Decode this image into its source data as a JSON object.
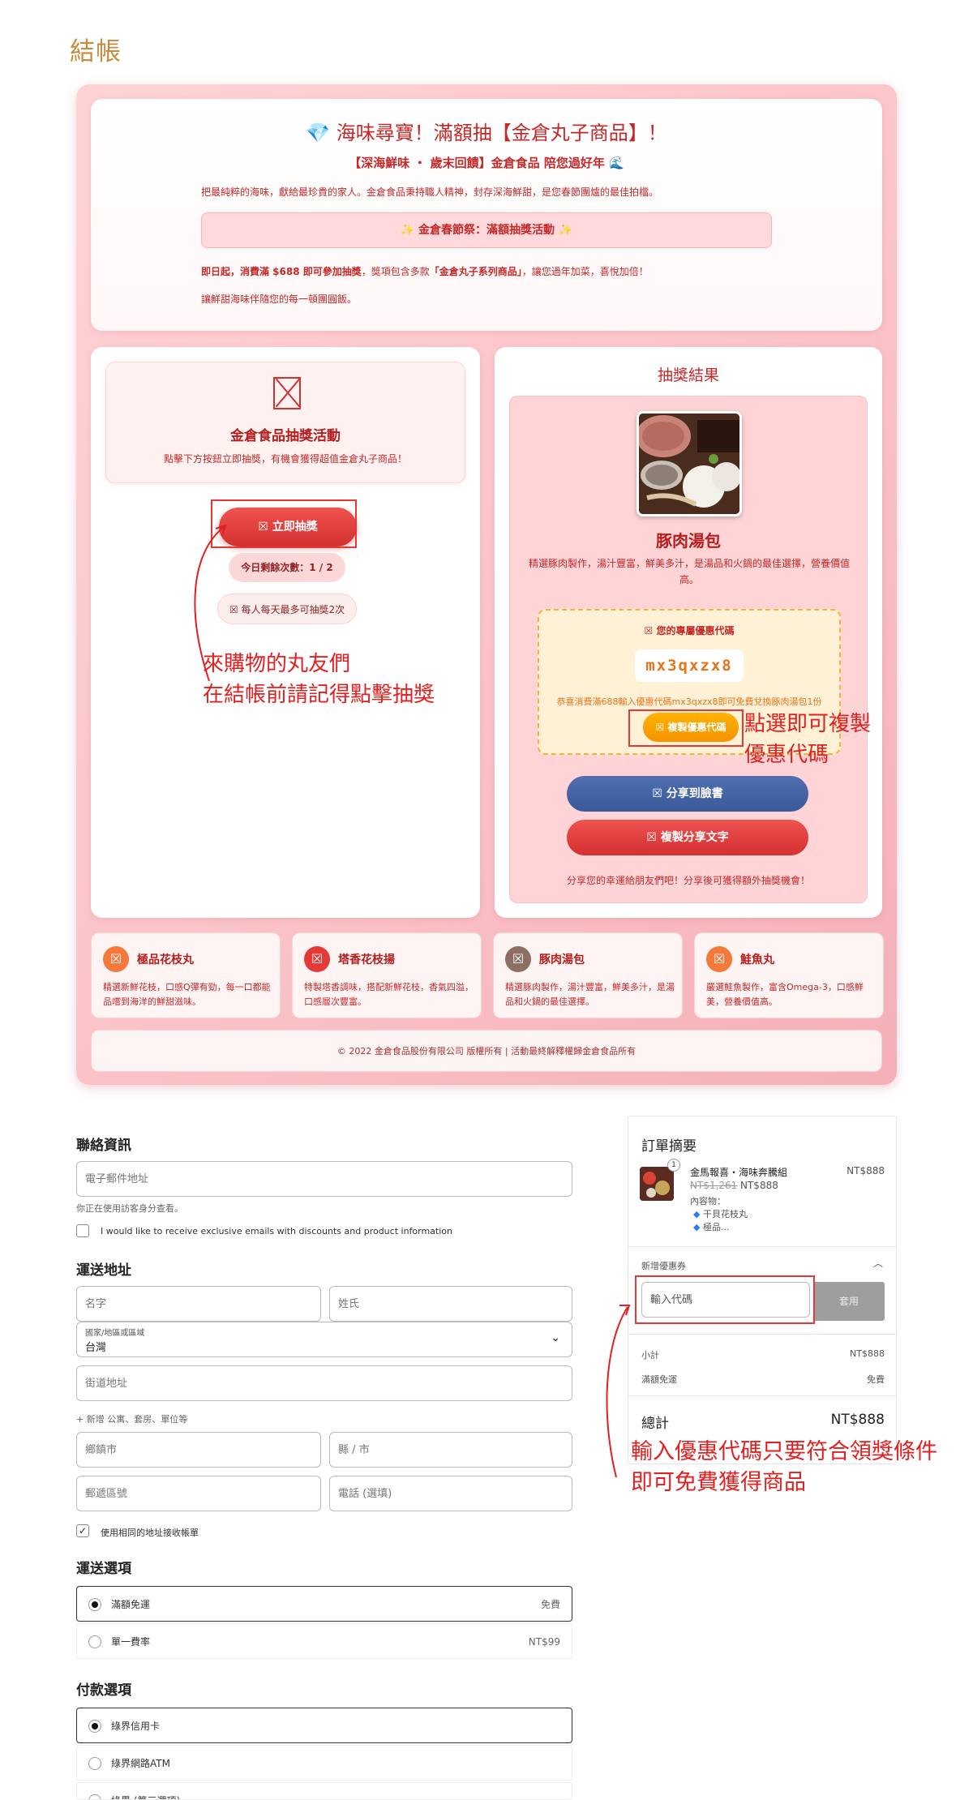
{
  "page": {
    "title": "結帳"
  },
  "promo": {
    "title": "💎 海味尋寶！滿額抽【金倉丸子商品】！",
    "subtitle": "【深海鮮味 ・ 歲末回饋】金倉食品 陪您過好年 🌊",
    "intro": "把最純粹的海味，獻給最珍貴的家人。金倉食品秉持職人精神，封存深海鮮甜，是您春節團爐的最佳拍檔。",
    "banner": "✨ 金倉春節祭：滿額抽獎活動 ✨",
    "rule_strong": "即日起，消費滿 $688 即可參加抽獎",
    "rule_mid": "，獎項包含多款",
    "rule_product": "「金倉丸子系列商品」",
    "rule_end": "，讓您過年加菜，喜悅加倍！",
    "closing": "讓鮮甜海味伴隨您的每一頓團圓飯。"
  },
  "lucky": {
    "title": "金倉食品抽獎活動",
    "desc": "點擊下方按鈕立即抽獎，有機會獲得超值金倉丸子商品！",
    "draw_button": "☒ 立即抽獎",
    "remaining": "今日剩餘次數：1 / 2",
    "limit": "☒ 每人每天最多可抽獎2次"
  },
  "annotations": {
    "left_line1": "來購物的丸友們",
    "left_line2": "在結帳前請記得點擊抽獎",
    "copy_line1": "點選即可複製",
    "copy_line2": "優惠代碼",
    "coupon_line1": "輸入優惠代碼只要符合領獎條件",
    "coupon_line2": "即可免費獲得商品"
  },
  "result": {
    "title": "抽獎結果",
    "product_name": "豚肉湯包",
    "product_desc": "精選豚肉製作，湯汁豐富，鮮美多汁，是湯品和火鍋的最佳選擇，營養價值高。",
    "coupon_label": "☒ 您的專屬優惠代碼",
    "coupon_code": "mx3qxzx8",
    "coupon_text": "恭喜消費滿688輸入優惠代碼mx3qxzx8即可免費兌換豚肉湯包1份",
    "copy_button": "☒ 複製優惠代碼",
    "fb_button": "☒ 分享到臉書",
    "share_button": "☒ 複製分享文字",
    "share_note": "分享您的幸運給朋友們吧！分享後可獲得額外抽獎機會！"
  },
  "features": [
    {
      "name": "極品花枝丸",
      "desc": "精選新鮮花枝，口感Q彈有勁，每一口都能品嚐到海洋的鮮甜滋味。",
      "color": "#f4793b"
    },
    {
      "name": "塔香花枝揚",
      "desc": "特製塔香調味，搭配新鮮花枝，香氣四溢，口感層次豐富。",
      "color": "#e53935"
    },
    {
      "name": "豚肉湯包",
      "desc": "精選豚肉製作，湯汁豐富，鮮美多汁，是湯品和火鍋的最佳選擇。",
      "color": "#8d6e63"
    },
    {
      "name": "鮭魚丸",
      "desc": "嚴選鮭魚製作，富含Omega-3，口感鮮美，營養價值高。",
      "color": "#f4793b"
    }
  ],
  "footer": "© 2022 金倉食品股份有限公司 版權所有 | 活動最終解釋權歸金倉食品所有",
  "checkout": {
    "contact_title": "聯絡資訊",
    "email_placeholder": "電子郵件地址",
    "guest_note": "你正在使用訪客身分查看。",
    "newsletter": "I would like to receive exclusive emails with discounts and product information",
    "shipping_title": "運送地址",
    "first_name": "名字",
    "last_name": "姓氏",
    "country_label": "國家/地區或區域",
    "country_value": "台灣",
    "street": "街道地址",
    "add_apt": "+ 新增 公寓、套房、單位等",
    "town": "鄉鎮市",
    "county": "縣 / 市",
    "postal": "郵遞區號",
    "phone": "電話 (選填)",
    "same_billing": "使用相同的地址接收帳單",
    "ship_options_title": "運送選項",
    "ship_free": "滿額免運",
    "ship_free_price": "免費",
    "ship_flat": "單一費率",
    "ship_flat_price": "NT$99",
    "payment_title": "付款選項",
    "pay_card": "綠界信用卡",
    "pay_atm": "綠界網路ATM",
    "pay_third": "綠界 (第三選項)"
  },
  "summary": {
    "title": "訂單摘要",
    "qty": "1",
    "item_name": "金馬報喜・海味奔騰組",
    "item_price": "NT$888",
    "old_price": "NT$1,261",
    "new_price": "NT$888",
    "contents_label": "內容物：",
    "content1": "干貝花枝丸",
    "content2": "極品...",
    "coupon_label": "新增優惠券",
    "coupon_placeholder": "輸入代碼",
    "apply": "套用",
    "subtotal_label": "小計",
    "subtotal": "NT$888",
    "ship_label": "滿額免運",
    "ship_value": "免費",
    "total_label": "總計",
    "total": "NT$888"
  }
}
